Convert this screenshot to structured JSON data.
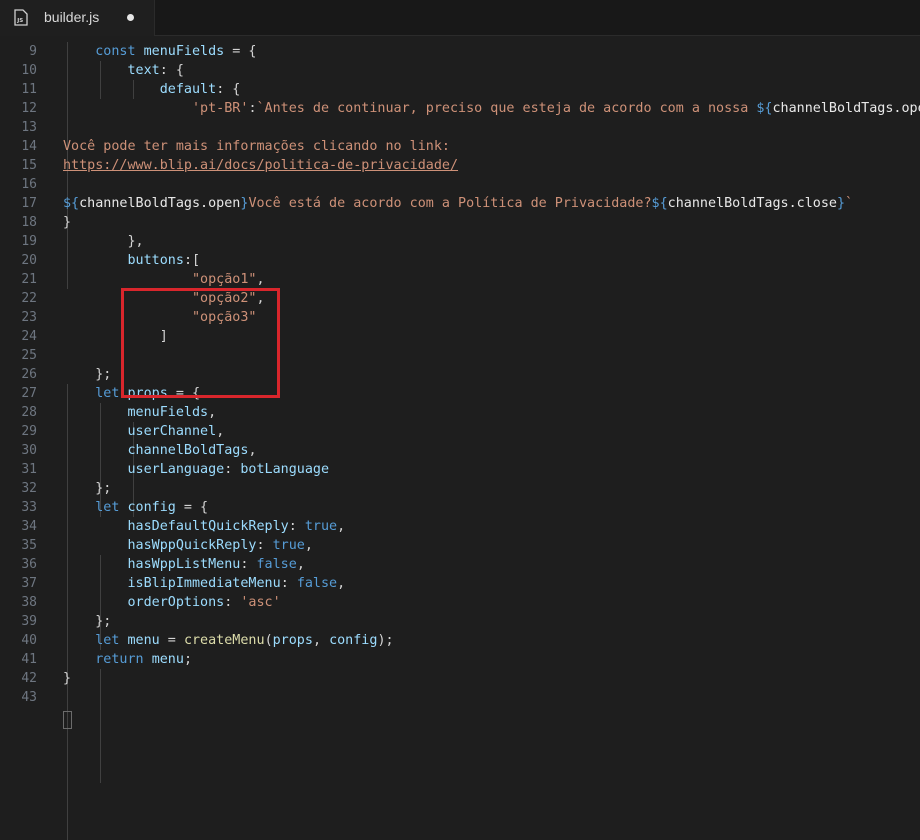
{
  "tab": {
    "icon": "js-file-icon",
    "label": "builder.js",
    "modified": true
  },
  "colors": {
    "keyword": "#569cd6",
    "variable": "#9cdcfe",
    "string": "#ce9178",
    "function": "#dcdcaa",
    "highlight_box": "#d9262c"
  },
  "lines": [
    {
      "number": "9",
      "tokens": [
        [
          "    ",
          "p"
        ],
        [
          "const",
          "kw"
        ],
        [
          " ",
          "p"
        ],
        [
          "menuFields",
          "var"
        ],
        [
          " = {",
          "p"
        ]
      ]
    },
    {
      "number": "10",
      "tokens": [
        [
          "        ",
          "p"
        ],
        [
          "text",
          "var"
        ],
        [
          ": {",
          "p"
        ]
      ]
    },
    {
      "number": "11",
      "tokens": [
        [
          "            ",
          "p"
        ],
        [
          "default",
          "var"
        ],
        [
          ": {",
          "p"
        ]
      ]
    },
    {
      "number": "12",
      "tokens": [
        [
          "                ",
          "p"
        ],
        [
          "'pt-BR'",
          "str"
        ],
        [
          ":",
          "p"
        ],
        [
          "`Antes de continuar, preciso que esteja de acordo com a nossa ",
          "str"
        ],
        [
          "${",
          "kw"
        ],
        [
          "channelBoldTags.open",
          "tplvar"
        ],
        [
          "}",
          "kw"
        ]
      ]
    },
    {
      "number": "13",
      "tokens": []
    },
    {
      "number": "14",
      "tokens": [
        [
          "Você pode ter mais informações clicando no link:",
          "str"
        ]
      ]
    },
    {
      "number": "15",
      "tokens": [
        [
          "https://www.blip.ai/docs/politica-de-privacidade/",
          "url"
        ]
      ]
    },
    {
      "number": "16",
      "tokens": []
    },
    {
      "number": "17",
      "tokens": [
        [
          "${",
          "kw"
        ],
        [
          "channelBoldTags.open",
          "tplvar"
        ],
        [
          "}",
          "kw"
        ],
        [
          "Você está de acordo com a Política de Privacidade?",
          "str"
        ],
        [
          "${",
          "kw"
        ],
        [
          "channelBoldTags.close",
          "tplvar"
        ],
        [
          "}",
          "kw"
        ],
        [
          "`",
          "str"
        ]
      ]
    },
    {
      "number": "18",
      "tokens": [
        [
          "}",
          "p"
        ]
      ]
    },
    {
      "number": "19",
      "tokens": [
        [
          "        },",
          "p"
        ]
      ]
    },
    {
      "number": "20",
      "tokens": [
        [
          "        ",
          "p"
        ],
        [
          "buttons",
          "var"
        ],
        [
          ":[",
          "p"
        ]
      ]
    },
    {
      "number": "21",
      "tokens": [
        [
          "                ",
          "p"
        ],
        [
          "\"opção1\"",
          "str"
        ],
        [
          ",",
          "p"
        ]
      ]
    },
    {
      "number": "22",
      "tokens": [
        [
          "                ",
          "p"
        ],
        [
          "\"opção2\"",
          "str"
        ],
        [
          ",",
          "p"
        ]
      ]
    },
    {
      "number": "23",
      "tokens": [
        [
          "                ",
          "p"
        ],
        [
          "\"opção3\"",
          "str"
        ]
      ]
    },
    {
      "number": "24",
      "tokens": [
        [
          "            ]",
          "p"
        ]
      ]
    },
    {
      "number": "25",
      "tokens": []
    },
    {
      "number": "26",
      "tokens": [
        [
          "    };",
          "p"
        ]
      ]
    },
    {
      "number": "27",
      "tokens": [
        [
          "    ",
          "p"
        ],
        [
          "let",
          "kw"
        ],
        [
          " ",
          "p"
        ],
        [
          "props",
          "var"
        ],
        [
          " = {",
          "p"
        ]
      ]
    },
    {
      "number": "28",
      "tokens": [
        [
          "        ",
          "p"
        ],
        [
          "menuFields",
          "var"
        ],
        [
          ",",
          "p"
        ]
      ]
    },
    {
      "number": "29",
      "tokens": [
        [
          "        ",
          "p"
        ],
        [
          "userChannel",
          "var"
        ],
        [
          ",",
          "p"
        ]
      ]
    },
    {
      "number": "30",
      "tokens": [
        [
          "        ",
          "p"
        ],
        [
          "channelBoldTags",
          "var"
        ],
        [
          ",",
          "p"
        ]
      ]
    },
    {
      "number": "31",
      "tokens": [
        [
          "        ",
          "p"
        ],
        [
          "userLanguage",
          "var"
        ],
        [
          ": ",
          "p"
        ],
        [
          "botLanguage",
          "var"
        ]
      ]
    },
    {
      "number": "32",
      "tokens": [
        [
          "    };",
          "p"
        ]
      ]
    },
    {
      "number": "33",
      "tokens": [
        [
          "    ",
          "p"
        ],
        [
          "let",
          "kw"
        ],
        [
          " ",
          "p"
        ],
        [
          "config",
          "var"
        ],
        [
          " = {",
          "p"
        ]
      ]
    },
    {
      "number": "34",
      "tokens": [
        [
          "        ",
          "p"
        ],
        [
          "hasDefaultQuickReply",
          "var"
        ],
        [
          ": ",
          "p"
        ],
        [
          "true",
          "kw"
        ],
        [
          ",",
          "p"
        ]
      ]
    },
    {
      "number": "35",
      "tokens": [
        [
          "        ",
          "p"
        ],
        [
          "hasWppQuickReply",
          "var"
        ],
        [
          ": ",
          "p"
        ],
        [
          "true",
          "kw"
        ],
        [
          ",",
          "p"
        ]
      ]
    },
    {
      "number": "36",
      "tokens": [
        [
          "        ",
          "p"
        ],
        [
          "hasWppListMenu",
          "var"
        ],
        [
          ": ",
          "p"
        ],
        [
          "false",
          "kw"
        ],
        [
          ",",
          "p"
        ]
      ]
    },
    {
      "number": "37",
      "tokens": [
        [
          "        ",
          "p"
        ],
        [
          "isBlipImmediateMenu",
          "var"
        ],
        [
          ": ",
          "p"
        ],
        [
          "false",
          "kw"
        ],
        [
          ",",
          "p"
        ]
      ]
    },
    {
      "number": "38",
      "tokens": [
        [
          "        ",
          "p"
        ],
        [
          "orderOptions",
          "var"
        ],
        [
          ": ",
          "p"
        ],
        [
          "'asc'",
          "str"
        ]
      ]
    },
    {
      "number": "39",
      "tokens": [
        [
          "    };",
          "p"
        ]
      ]
    },
    {
      "number": "40",
      "tokens": [
        [
          "    ",
          "p"
        ],
        [
          "let",
          "kw"
        ],
        [
          " ",
          "p"
        ],
        [
          "menu",
          "var"
        ],
        [
          " = ",
          "p"
        ],
        [
          "createMenu",
          "fn"
        ],
        [
          "(",
          "p"
        ],
        [
          "props",
          "var"
        ],
        [
          ", ",
          "p"
        ],
        [
          "config",
          "var"
        ],
        [
          ");",
          "p"
        ]
      ]
    },
    {
      "number": "41",
      "tokens": [
        [
          "    ",
          "p"
        ],
        [
          "return",
          "kw"
        ],
        [
          " ",
          "p"
        ],
        [
          "menu",
          "var"
        ],
        [
          ";",
          "p"
        ]
      ]
    },
    {
      "number": "42",
      "tokens": [
        [
          "}",
          "p"
        ]
      ]
    },
    {
      "number": "43",
      "tokens": []
    }
  ]
}
